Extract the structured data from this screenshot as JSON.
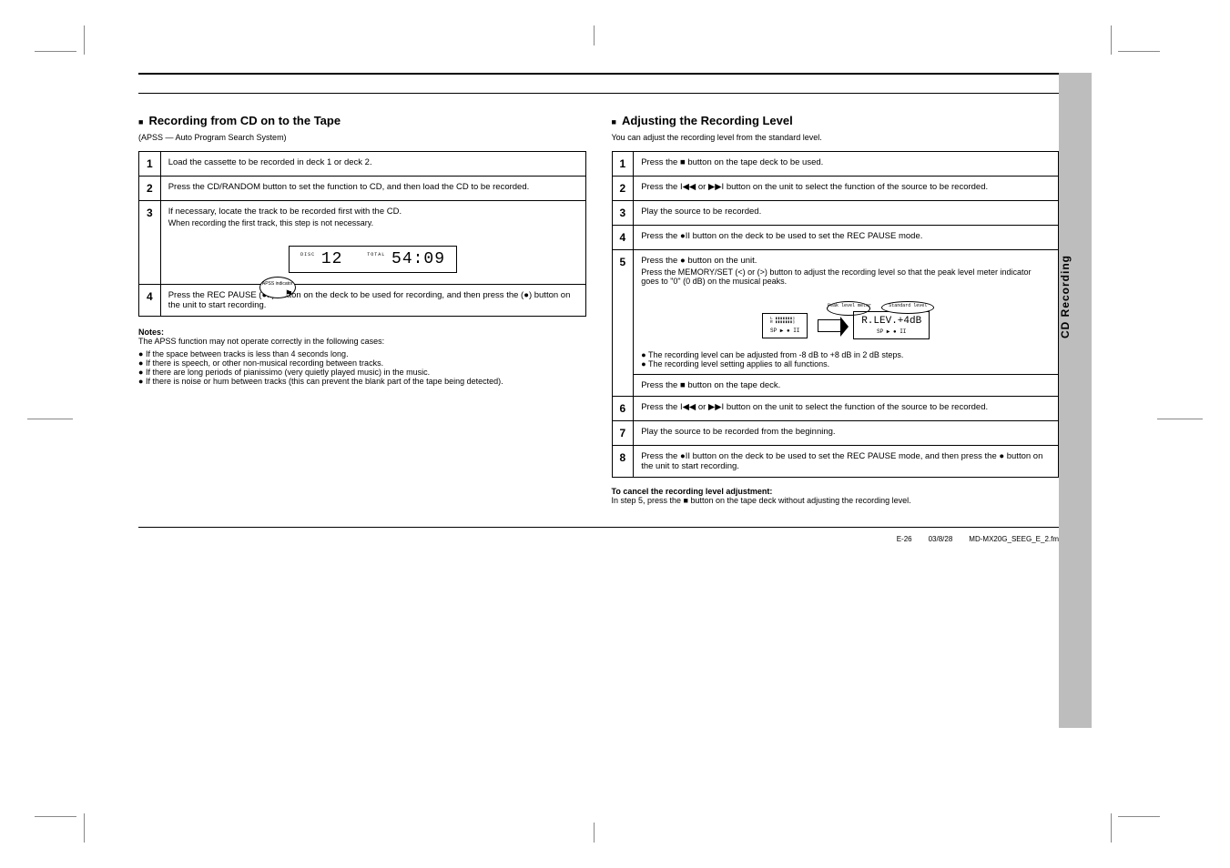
{
  "side_tab": "CD Recording",
  "left": {
    "heading_prefix": "■",
    "heading": "Recording from CD on to the Tape",
    "sub": "(APSS — Auto Program Search System)",
    "steps": [
      {
        "n": "1",
        "text": "Load the cassette to be recorded in deck 1 or deck 2."
      },
      {
        "n": "2",
        "text": "Press the CD/RANDOM button to set the function to CD, and then load the CD to be recorded."
      },
      {
        "n": "3",
        "text": "If necessary, locate the track to be recorded first with the CD.",
        "sub": "When recording the first track, this step is not necessary.",
        "lcd": {
          "disc_label": "DISC",
          "disc": "12",
          "total_label": "TOTAL",
          "time": "54:09",
          "bubble": "APSS indicator"
        }
      },
      {
        "n": "4",
        "text": "Press the REC PAUSE (●II) button on the deck to be used for recording, and then press the (●) button on the unit to start recording."
      }
    ],
    "notes_title": "Notes:",
    "notes": [
      "The APSS function may not operate correctly in the following cases:",
      "If the space between tracks is less than 4 seconds long.",
      "If there is speech, or other non-musical recording between tracks.",
      "If there are long periods of pianissimo (very quietly played music) in the music.",
      "If there is noise or hum between tracks (this can prevent the blank part of the tape being detected)."
    ]
  },
  "right": {
    "heading_prefix": "■",
    "heading": "Adjusting the Recording Level",
    "sub": "You can adjust the recording level from the standard level.",
    "steps": [
      {
        "n": "1",
        "text": "Press the ■ button on the tape deck to be used."
      },
      {
        "n": "2",
        "text": "Press the I◀◀ or ▶▶I button on the unit to select the function of the source to be recorded."
      },
      {
        "n": "3",
        "text": "Play the source to be recorded."
      },
      {
        "n": "4",
        "text": "Press the ●II button on the deck to be used to set the REC PAUSE mode."
      },
      {
        "n": "5a",
        "text": "Press the ● button on the unit.",
        "sub": "Press the MEMORY/SET (<) or (>) button to adjust the recording level so that the peak level meter indicator goes to \"0\" (0 dB) on the musical peaks.",
        "lcd_left_bubble": "Peak level meter",
        "lcd_right_bubble": "Standard level",
        "lcd_right_text": "R.LEV.+4dB",
        "tape_sp": "SP",
        "tape_icons": "▶ ● II",
        "notes": [
          "The recording level can be adjusted from -8 dB to +8 dB in 2 dB steps.",
          "The recording level setting applies to all functions."
        ]
      },
      {
        "n": "5b",
        "text": "Press the ■ button on the tape deck."
      },
      {
        "n": "6",
        "text": "Press the I◀◀ or ▶▶I button on the unit to select the function of the source to be recorded."
      },
      {
        "n": "7",
        "text": "Play the source to be recorded from the beginning."
      },
      {
        "n": "8",
        "text": "Press the ●II button on the deck to be used to set the REC PAUSE mode, and then press the ● button on the unit to start recording."
      }
    ],
    "cancel_title": "To cancel the recording level adjustment:",
    "cancel_text": "In step 5, press the ■ button on the tape deck without adjusting the recording level."
  },
  "footer": {
    "page": "E-26",
    "code": "03/8/28",
    "file": "MD-MX20G_SEEG_E_2.fm"
  }
}
